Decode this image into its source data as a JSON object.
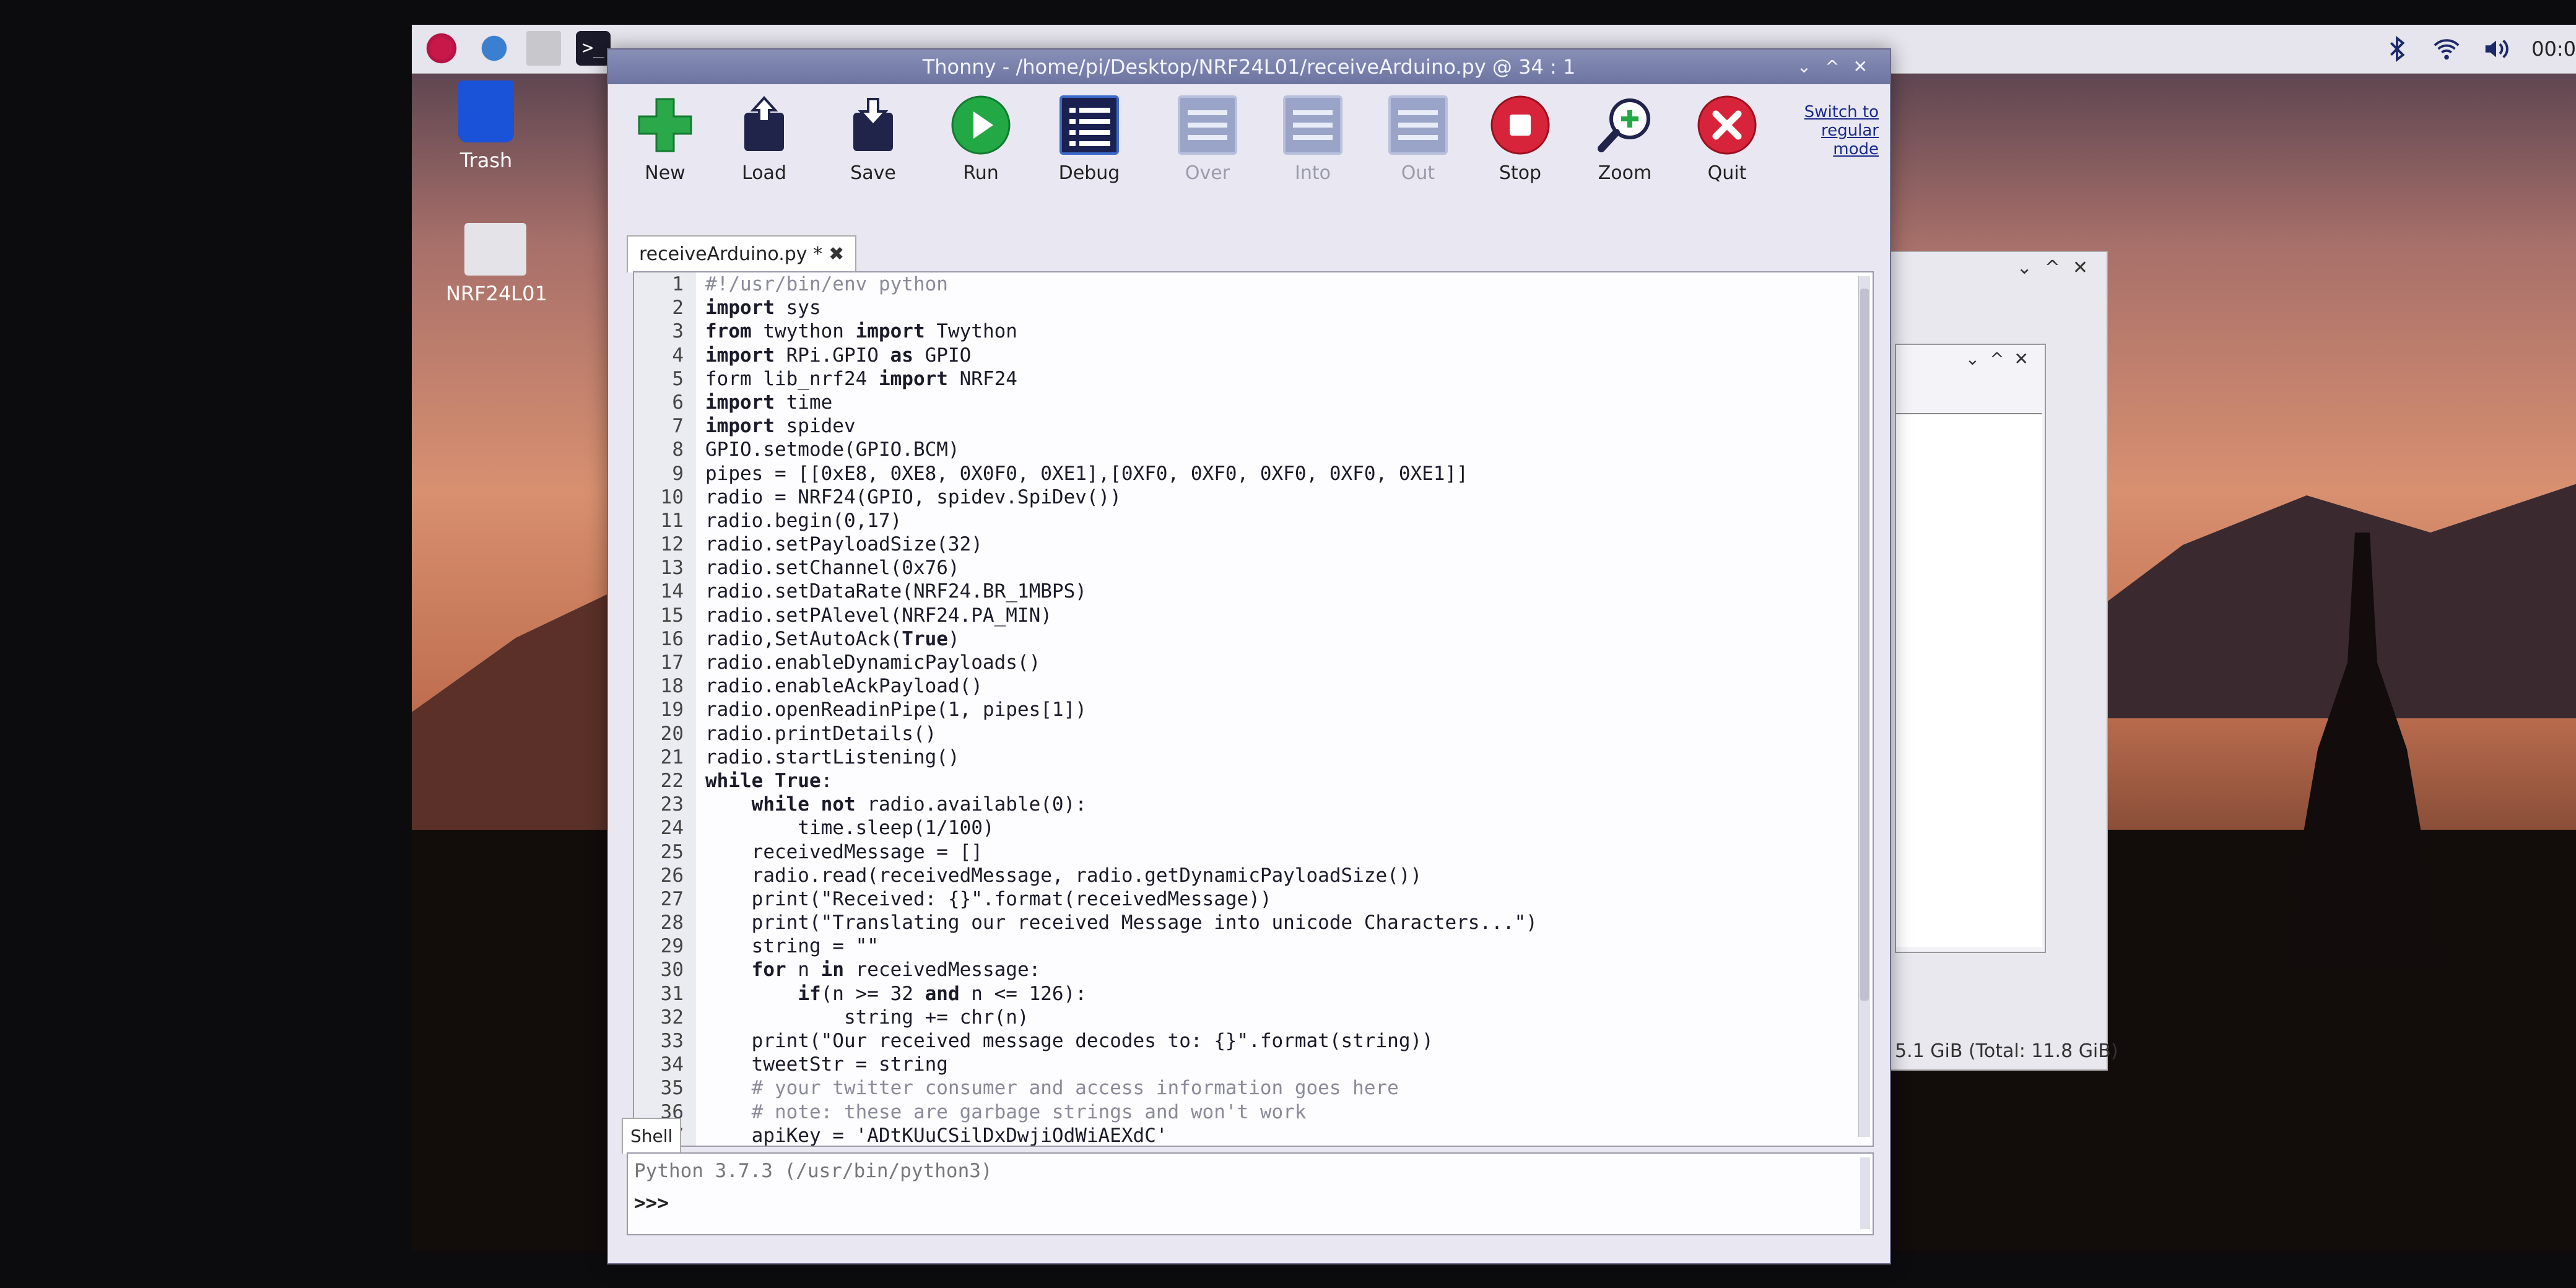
{
  "window": {
    "title": "Thonny  -  /home/pi/Desktop/NRF24L01/receiveArduino.py  @  34 : 1",
    "controls": [
      "⌄",
      "^",
      "✕"
    ]
  },
  "taskbar": {
    "clock": "00:0",
    "terminal_glyph": ">_"
  },
  "desktop": {
    "icons": [
      {
        "label": "Trash"
      },
      {
        "label": "NRF24L01"
      }
    ],
    "storage_text": "5.1 GiB (Total: 11.8 GiB)"
  },
  "toolbar": {
    "buttons": [
      {
        "label": "New",
        "icon": "plus-icon",
        "enabled": true
      },
      {
        "label": "Load",
        "icon": "folder-open-icon",
        "enabled": true
      },
      {
        "label": "Save",
        "icon": "save-icon",
        "enabled": true
      },
      {
        "label": "Run",
        "icon": "play-icon",
        "enabled": true
      },
      {
        "label": "Debug",
        "icon": "debug-icon",
        "enabled": true
      },
      {
        "label": "Over",
        "icon": "step-over-icon",
        "enabled": false
      },
      {
        "label": "Into",
        "icon": "step-into-icon",
        "enabled": false
      },
      {
        "label": "Out",
        "icon": "step-out-icon",
        "enabled": false
      },
      {
        "label": "Stop",
        "icon": "stop-icon",
        "enabled": true
      },
      {
        "label": "Zoom",
        "icon": "zoom-icon",
        "enabled": true
      },
      {
        "label": "Quit",
        "icon": "quit-icon",
        "enabled": true
      }
    ],
    "switch_mode": "Switch to regular mode"
  },
  "editor": {
    "tab_label": "receiveArduino.py *",
    "tab_close": "✖",
    "lines": [
      "#!/usr/bin/env python",
      "import sys",
      "from twython import Twython",
      "import RPi.GPIO as GPIO",
      "form lib_nrf24 import NRF24",
      "import time",
      "import spidev",
      "GPIO.setmode(GPIO.BCM)",
      "pipes = [[0xE8, 0XE8, 0X0F0, 0XE1],[0XF0, 0XF0, 0XF0, 0XF0, 0XE1]]",
      "radio = NRF24(GPIO, spidev.SpiDev())",
      "radio.begin(0,17)",
      "radio.setPayloadSize(32)",
      "radio.setChannel(0x76)",
      "radio.setDataRate(NRF24.BR_1MBPS)",
      "radio.setPAlevel(NRF24.PA_MIN)",
      "radio,SetAutoAck(True)",
      "radio.enableDynamicPayloads()",
      "radio.enableAckPayload()",
      "radio.openReadinPipe(1, pipes[1])",
      "radio.printDetails()",
      "radio.startListening()",
      "while True:",
      "    while not radio.available(0):",
      "        time.sleep(1/100)",
      "    receivedMessage = []",
      "    radio.read(receivedMessage, radio.getDynamicPayloadSize())",
      "    print(\"Received: {}\".format(receivedMessage))",
      "    print(\"Translating our received Message into unicode Characters...\")",
      "    string = \"\"",
      "    for n in receivedMessage:",
      "        if(n >= 32 and n <= 126):",
      "            string += chr(n)",
      "    print(\"Our received message decodes to: {}\".format(string))",
      "    tweetStr = string",
      "    # your twitter consumer and access information goes here",
      "    # note: these are garbage strings and won't work",
      "    apiKey = 'ADtKUuCSilDxDwjiOdWiAEXdC'"
    ]
  },
  "shell": {
    "tab_label": "Shell",
    "version_line": "Python 3.7.3 (/usr/bin/python3)",
    "prompt": ">>>"
  },
  "colors": {
    "run_green": "#22a844",
    "stop_red": "#d8243a",
    "new_green": "#2aa84a",
    "keyword": "#1a1a2a",
    "comment": "#8a8a9a"
  }
}
